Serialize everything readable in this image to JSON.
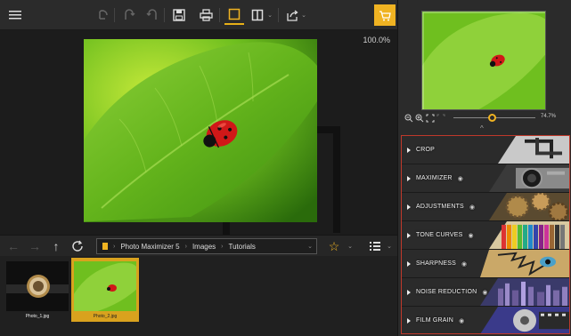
{
  "toolbar": {
    "menu_icon": "hamburger-menu-icon",
    "undo_icon": "undo-icon",
    "redo_icon": "redo-icon",
    "reset_icon": "reset-icon",
    "save_icon": "save-icon",
    "print_icon": "print-icon",
    "single_view_icon": "single-view-icon",
    "compare_view_icon": "split-compare-icon",
    "share_icon": "share-icon",
    "cart_icon": "shopping-cart-icon",
    "accent": "#f0b322"
  },
  "canvas": {
    "zoom_readout": "100.0%",
    "photo_subject": "ladybug-on-leaf"
  },
  "navbar": {
    "back_icon": "arrow-left-icon",
    "forward_icon": "arrow-right-icon",
    "up_icon": "arrow-up-icon",
    "refresh_icon": "refresh-icon",
    "crumbs": [
      "Photo Maximizer 5",
      "Images",
      "Tutorials"
    ],
    "favorite_icon": "star-icon",
    "list_view_icon": "list-view-icon"
  },
  "filmstrip": {
    "items": [
      {
        "label": "Photo_1.jpg",
        "selected": false
      },
      {
        "label": "Photo_2.jpg",
        "selected": true
      }
    ]
  },
  "navigator": {
    "zoom_percent": "74.7%",
    "zoom_value": 0.47
  },
  "tools": [
    {
      "label": "CROP",
      "has_eye": false
    },
    {
      "label": "MAXIMIZER",
      "has_eye": true
    },
    {
      "label": "ADJUSTMENTS",
      "has_eye": true
    },
    {
      "label": "TONE CURVES",
      "has_eye": true
    },
    {
      "label": "SHARPNESS",
      "has_eye": true
    },
    {
      "label": "NOISE REDUCTION",
      "has_eye": true
    },
    {
      "label": "FILM GRAIN",
      "has_eye": true
    }
  ]
}
